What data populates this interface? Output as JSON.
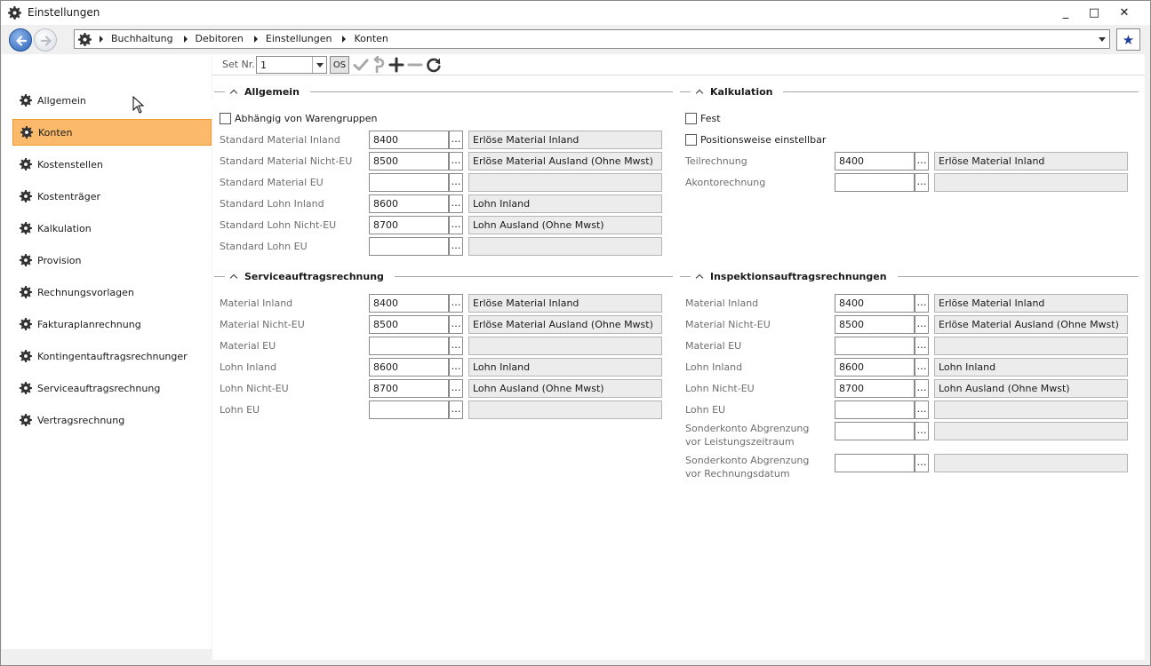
{
  "window": {
    "title": "Einstellungen",
    "controls": [
      "_",
      "□",
      "✕"
    ]
  },
  "breadcrumb": [
    "Buchhaltung",
    "Debitoren",
    "Einstellungen",
    "Konten"
  ],
  "sidebar": {
    "items": [
      {
        "label": "Allgemein"
      },
      {
        "label": "Konten"
      },
      {
        "label": "Kostenstellen"
      },
      {
        "label": "Kostenträger"
      },
      {
        "label": "Kalkulation"
      },
      {
        "label": "Provision"
      },
      {
        "label": "Rechnungsvorlagen"
      },
      {
        "label": "Fakturaplanrechnung"
      },
      {
        "label": "Kontingentauftragsrechnunger"
      },
      {
        "label": "Serviceauftragsrechnung"
      },
      {
        "label": "Vertragsrechnung"
      }
    ],
    "active": "Konten"
  },
  "toolbar": {
    "set_label": "Set Nr.",
    "set_value": "1",
    "os_label": "OS"
  },
  "allgemein": {
    "title": "Allgemein",
    "checkbox": "Abhängig von Warengruppen",
    "rows": [
      {
        "label": "Standard Material Inland",
        "value": "8400",
        "desc": "Erlöse Material Inland"
      },
      {
        "label": "Standard Material Nicht-EU",
        "value": "8500",
        "desc": "Erlöse Material Ausland (Ohne Mwst)"
      },
      {
        "label": "Standard Material EU",
        "value": "",
        "desc": ""
      },
      {
        "label": "Standard Lohn Inland",
        "value": "8600",
        "desc": "Lohn Inland"
      },
      {
        "label": "Standard Lohn Nicht-EU",
        "value": "8700",
        "desc": "Lohn Ausland (Ohne Mwst)"
      },
      {
        "label": "Standard Lohn EU",
        "value": "",
        "desc": ""
      }
    ]
  },
  "kalkulation": {
    "title": "Kalkulation",
    "checkboxes": [
      "Fest",
      "Positionsweise einstellbar"
    ],
    "rows": [
      {
        "label": "Teilrechnung",
        "value": "8400",
        "desc": "Erlöse Material Inland"
      },
      {
        "label": "Akontorechnung",
        "value": "",
        "desc": ""
      }
    ]
  },
  "service": {
    "title": "Serviceauftragsrechnung",
    "rows": [
      {
        "label": "Material Inland",
        "value": "8400",
        "desc": "Erlöse Material Inland"
      },
      {
        "label": "Material Nicht-EU",
        "value": "8500",
        "desc": "Erlöse Material Ausland (Ohne Mwst)"
      },
      {
        "label": "Material EU",
        "value": "",
        "desc": ""
      },
      {
        "label": "Lohn Inland",
        "value": "8600",
        "desc": "Lohn Inland"
      },
      {
        "label": "Lohn Nicht-EU",
        "value": "8700",
        "desc": "Lohn Ausland (Ohne Mwst)"
      },
      {
        "label": "Lohn EU",
        "value": "",
        "desc": ""
      }
    ]
  },
  "inspektion": {
    "title": "Inspektionsauftragsrechnungen",
    "rows": [
      {
        "label": "Material Inland",
        "value": "8400",
        "desc": "Erlöse Material Inland"
      },
      {
        "label": "Material Nicht-EU",
        "value": "8500",
        "desc": "Erlöse Material Ausland (Ohne Mwst)"
      },
      {
        "label": "Material EU",
        "value": "",
        "desc": ""
      },
      {
        "label": "Lohn Inland",
        "value": "8600",
        "desc": "Lohn Inland"
      },
      {
        "label": "Lohn Nicht-EU",
        "value": "8700",
        "desc": "Lohn Ausland (Ohne Mwst)"
      },
      {
        "label": "Lohn EU",
        "value": "",
        "desc": ""
      },
      {
        "label": "Sonderkonto Abgrenzung vor Leistungszeitraum",
        "value": "",
        "desc": ""
      },
      {
        "label": "Sonderkonto Abgrenzung vor Rechnungsdatum",
        "value": "",
        "desc": ""
      }
    ]
  }
}
